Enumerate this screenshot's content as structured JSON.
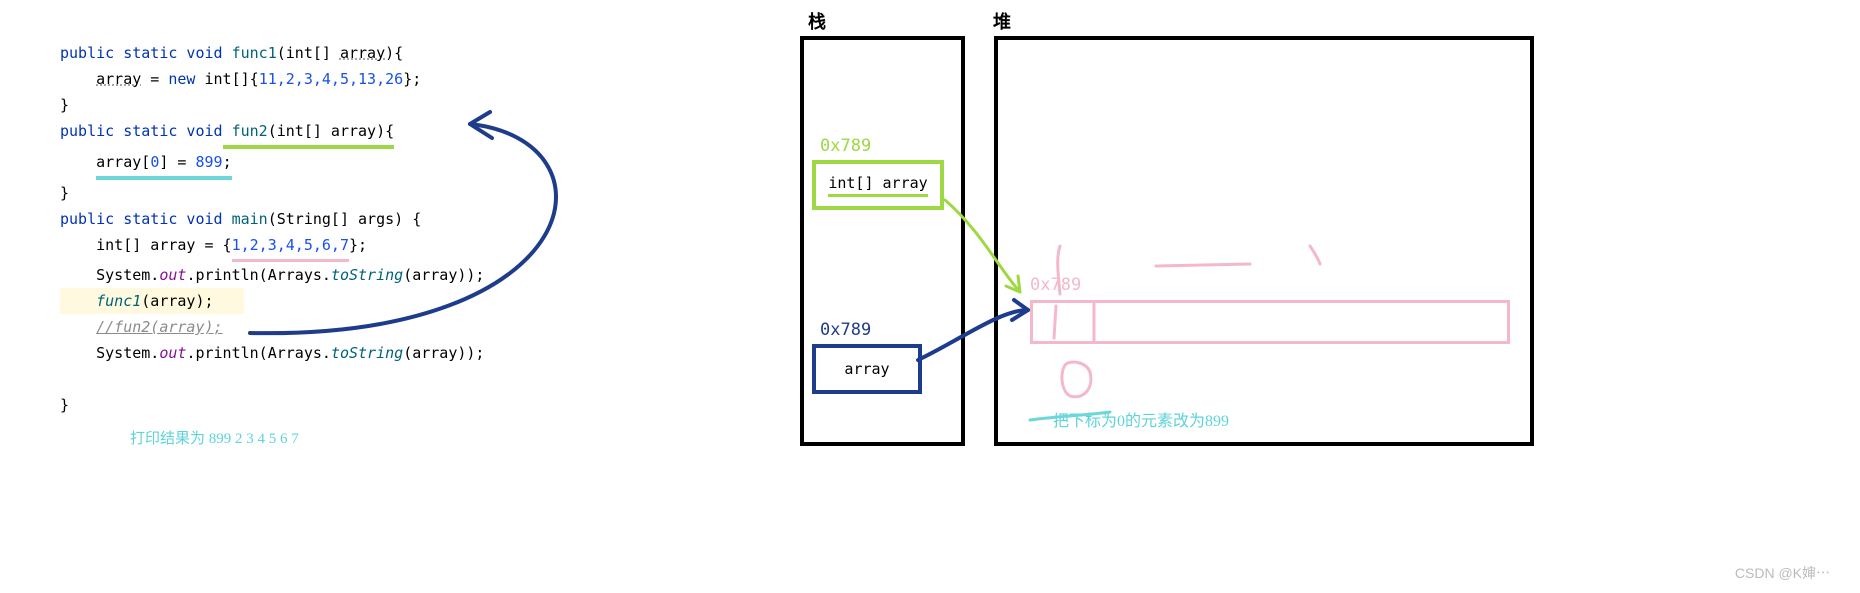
{
  "code": {
    "l1_kw": "public static void",
    "l1_fn": " func1",
    "l1_sig": "(int[] ",
    "l1_param": "array",
    "l1_end": "){",
    "l2_var": "array",
    "l2_eq": " = ",
    "l2_new": "new",
    "l2_type": " int[]{",
    "l2_vals": "11,2,3,4,5,13,26",
    "l2_end": "};",
    "l3": "}",
    "l4_kw": "public static void",
    "l4_fn": " fun2",
    "l4_sig": "(int[] array){",
    "l5_left": "array[",
    "l5_idx": "0",
    "l5_mid": "] = ",
    "l5_val": "899",
    "l5_end": ";",
    "l6": "}",
    "l7_kw": "public static void",
    "l7_fn": " main",
    "l7_sig": "(String[] args) {",
    "l8_a": "int[] array = {",
    "l8_vals": "1,2,3,4,5,6,7",
    "l8_end": "};",
    "l9_a": "System.",
    "l9_out": "out",
    "l9_b": ".println(Arrays.",
    "l9_ts": "toString",
    "l9_c": "(array));",
    "l10_fn": "func1",
    "l10_arg": "(array);",
    "l11": "//fun2(array);",
    "l12_a": "System.",
    "l12_out": "out",
    "l12_b": ".println(Arrays.",
    "l12_ts": "toString",
    "l12_c": "(array));",
    "l14": "}",
    "result": "打印结果为 899 2 3 4 5 6 7"
  },
  "diagram": {
    "stack_label": "栈",
    "heap_label": "堆",
    "addr_green": "0x789",
    "frame_green_text": "int[] array",
    "addr_blue": "0x789",
    "frame_blue_text": "array",
    "addr_pink": "0x789",
    "pink_annot": "把下标为0的元素改为899"
  },
  "watermark": "CSDN @K婶⋯"
}
